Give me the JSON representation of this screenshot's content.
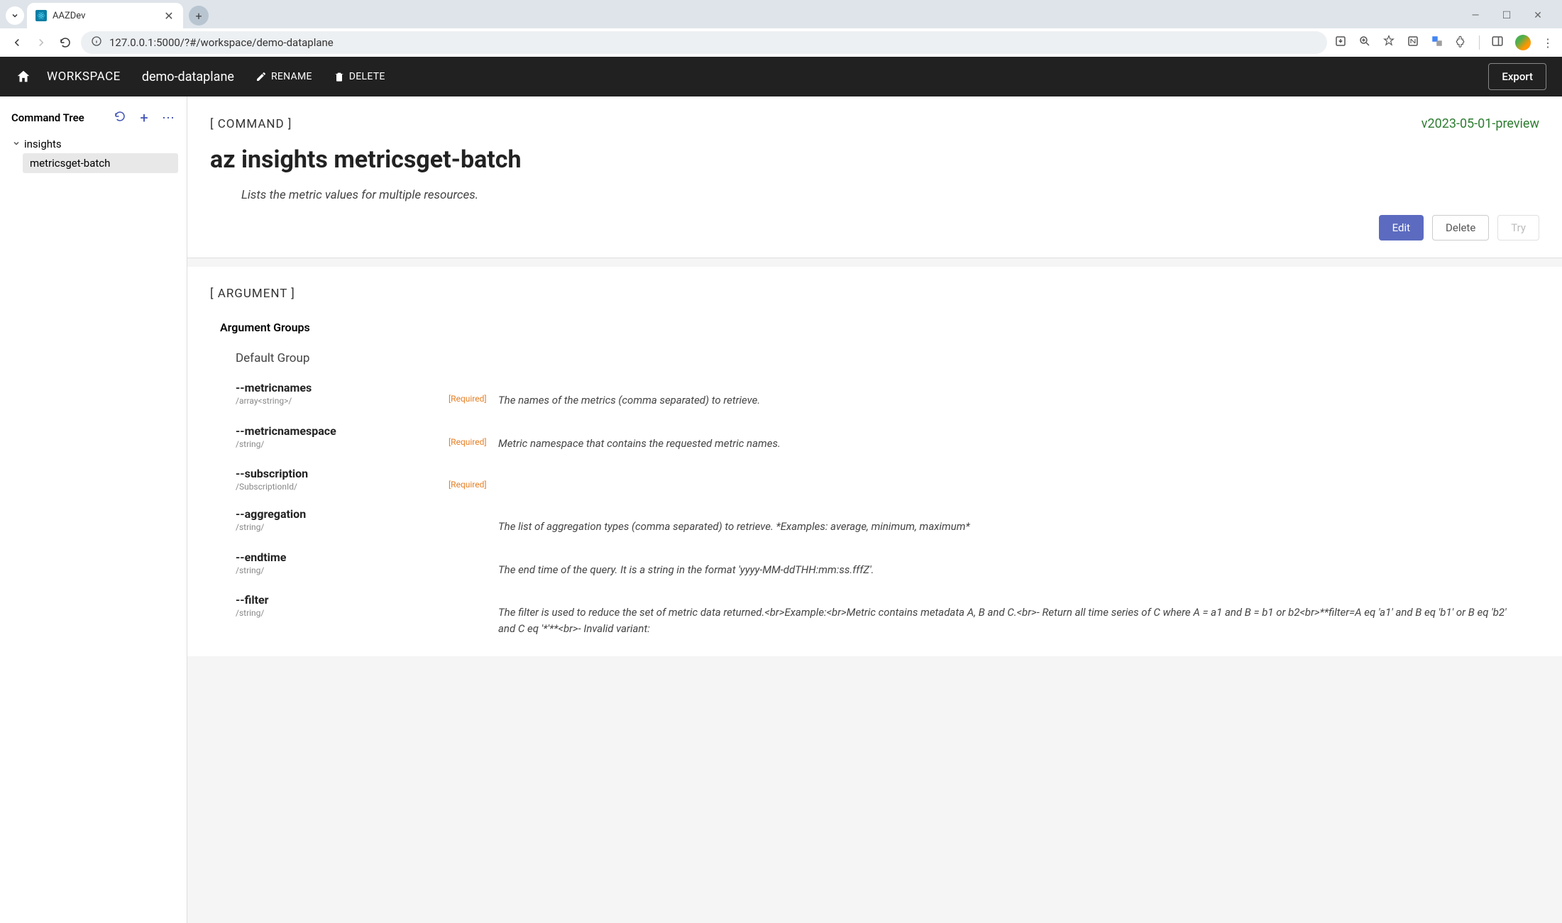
{
  "browser": {
    "tab_title": "AAZDev",
    "url": "127.0.0.1:5000/?#/workspace/demo-dataplane"
  },
  "header": {
    "workspace_label": "WORKSPACE",
    "workspace_name": "demo-dataplane",
    "rename": "RENAME",
    "delete": "DELETE",
    "export": "Export"
  },
  "sidebar": {
    "title": "Command Tree",
    "root": "insights",
    "leaf": "metricsget-batch"
  },
  "command": {
    "tag": "[ COMMAND ]",
    "version": "v2023-05-01-preview",
    "title": "az insights metricsget-batch",
    "description": "Lists the metric values for multiple resources.",
    "edit": "Edit",
    "delete": "Delete",
    "try": "Try"
  },
  "argument": {
    "tag": "[ ARGUMENT ]",
    "groups_title": "Argument Groups",
    "group_name": "Default Group",
    "required_label": "[Required]",
    "items": [
      {
        "name": "--metricnames",
        "type": "/array<string>/",
        "required": true,
        "desc": "The names of the metrics (comma separated) to retrieve."
      },
      {
        "name": "--metricnamespace",
        "type": "/string/",
        "required": true,
        "desc": "Metric namespace that contains the requested metric names."
      },
      {
        "name": "--subscription",
        "type": "/SubscriptionId/",
        "required": true,
        "desc": ""
      },
      {
        "name": "--aggregation",
        "type": "/string/",
        "required": false,
        "desc": "The list of aggregation types (comma separated) to retrieve. *Examples: average, minimum, maximum*"
      },
      {
        "name": "--endtime",
        "type": "/string/",
        "required": false,
        "desc": "The end time of the query. It is a string in the format 'yyyy-MM-ddTHH:mm:ss.fffZ'."
      },
      {
        "name": "--filter",
        "type": "/string/",
        "required": false,
        "desc": "The filter is used to reduce the set of metric data returned.<br>Example:<br>Metric contains metadata A, B and C.<br>- Return all time series of C where A = a1 and B = b1 or b2<br>**filter=A eq 'a1' and B eq 'b1' or B eq 'b2' and C eq '*'**<br>- Invalid variant:"
      }
    ]
  }
}
